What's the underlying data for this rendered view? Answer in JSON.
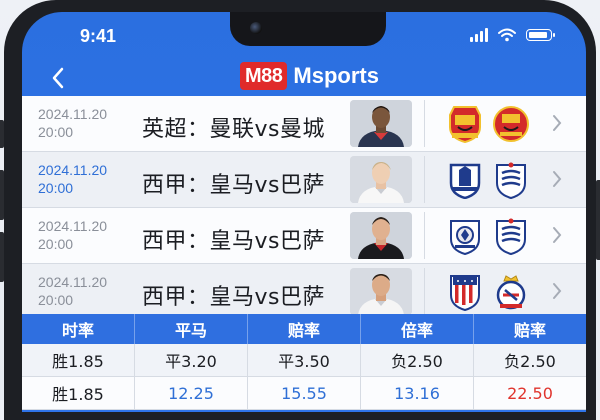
{
  "status_bar": {
    "time": "9:41"
  },
  "header": {
    "logo_badge": "M88",
    "logo_text": "Msports"
  },
  "matches": [
    {
      "date": "2024.11.20",
      "time": "20:00",
      "title": "英超：曼联vs曼城",
      "date_color": "#8a8f99"
    },
    {
      "date": "2024.11.20",
      "time": "20:00",
      "title": "西甲：皇马vs巴萨",
      "date_color": "#2f6fd6"
    },
    {
      "date": "2024.11.20",
      "time": "20:00",
      "title": "西甲：皇马vs巴萨",
      "date_color": "#8a8f99"
    },
    {
      "date": "2024.11.20",
      "time": "20:00",
      "title": "西甲：皇马vs巴萨",
      "date_color": "#8a8f99"
    }
  ],
  "odds_table": {
    "headers": [
      "时率",
      "平马",
      "赔率",
      "倍率",
      "赔率"
    ],
    "rows": [
      [
        "胜1.85",
        "平3.20",
        "平3.50",
        "负2.50",
        "负2.50"
      ],
      [
        "胜1.85",
        "12.25",
        "15.55",
        "13.16",
        "22.50"
      ]
    ]
  },
  "colors": {
    "accent_blue": "#2f6fe0",
    "brand_red": "#e02a2a",
    "odds_red": "#e0342d"
  }
}
